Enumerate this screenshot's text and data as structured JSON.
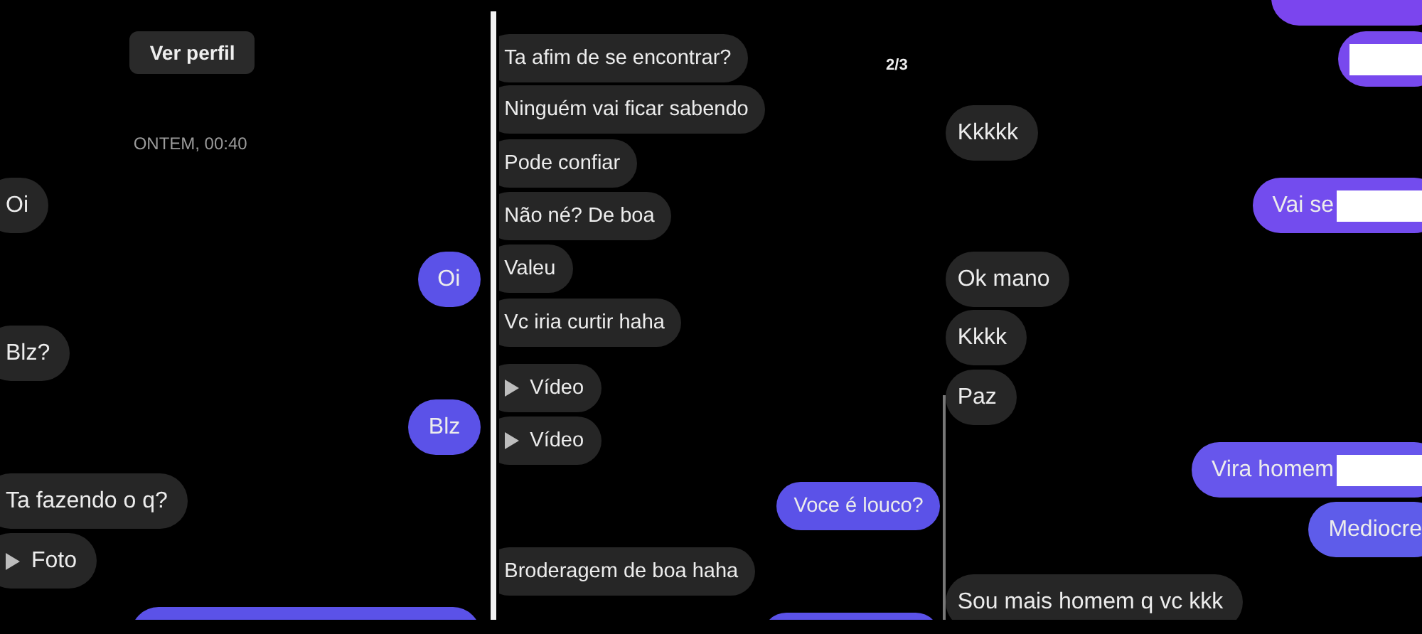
{
  "panels": [
    {
      "items": [
        {
          "kind": "button",
          "label": "Ver perfil"
        },
        {
          "kind": "timestamp",
          "text": "ONTEM, 00:40"
        },
        {
          "kind": "message",
          "outgoing": false,
          "text": "Oi"
        },
        {
          "kind": "message",
          "outgoing": true,
          "text": "Oi"
        },
        {
          "kind": "message",
          "outgoing": false,
          "text": "Blz?"
        },
        {
          "kind": "message",
          "outgoing": true,
          "text": "Blz"
        },
        {
          "kind": "message",
          "outgoing": false,
          "text": "Ta fazendo o q?"
        },
        {
          "kind": "media",
          "outgoing": false,
          "text": "Foto"
        },
        {
          "kind": "message",
          "outgoing": true
        }
      ]
    },
    {
      "counter": "2/3",
      "items": [
        {
          "kind": "message",
          "outgoing": false,
          "text": "Ta afim de se encontrar?"
        },
        {
          "kind": "message",
          "outgoing": false,
          "text": "Ninguém vai ficar sabendo"
        },
        {
          "kind": "message",
          "outgoing": false,
          "text": "Pode confiar"
        },
        {
          "kind": "message",
          "outgoing": false,
          "text": "Não né? De boa"
        },
        {
          "kind": "message",
          "outgoing": false,
          "text": "Valeu"
        },
        {
          "kind": "message",
          "outgoing": false,
          "text": "Vc iria curtir haha"
        },
        {
          "kind": "media",
          "outgoing": false,
          "text": "Vídeo"
        },
        {
          "kind": "media",
          "outgoing": false,
          "text": "Vídeo"
        },
        {
          "kind": "message",
          "outgoing": true,
          "text": "Voce é louco?"
        },
        {
          "kind": "message",
          "outgoing": false,
          "text": "Broderagem de boa haha"
        },
        {
          "kind": "message",
          "outgoing": true
        }
      ]
    },
    {
      "items": [
        {
          "kind": "message",
          "outgoing": true,
          "color": "#7b45ee"
        },
        {
          "kind": "message",
          "outgoing": true,
          "color": "#7849ee",
          "redacted": true
        },
        {
          "kind": "message",
          "outgoing": false,
          "text": "Kkkkk"
        },
        {
          "kind": "message",
          "outgoing": true,
          "color": "#734cee",
          "text": "Vai se",
          "redacted": true
        },
        {
          "kind": "message",
          "outgoing": false,
          "text": "Ok mano"
        },
        {
          "kind": "message",
          "outgoing": false,
          "text": "Kkkk"
        },
        {
          "kind": "message",
          "outgoing": false,
          "text": "Paz"
        },
        {
          "kind": "message",
          "outgoing": true,
          "color": "#6756ec",
          "text": "Vira homem",
          "redacted": true
        },
        {
          "kind": "message",
          "outgoing": true,
          "color": "#5e5cea",
          "text": "Mediocre"
        },
        {
          "kind": "message",
          "outgoing": false,
          "text": "Sou mais homem q vc kkk"
        }
      ]
    }
  ]
}
